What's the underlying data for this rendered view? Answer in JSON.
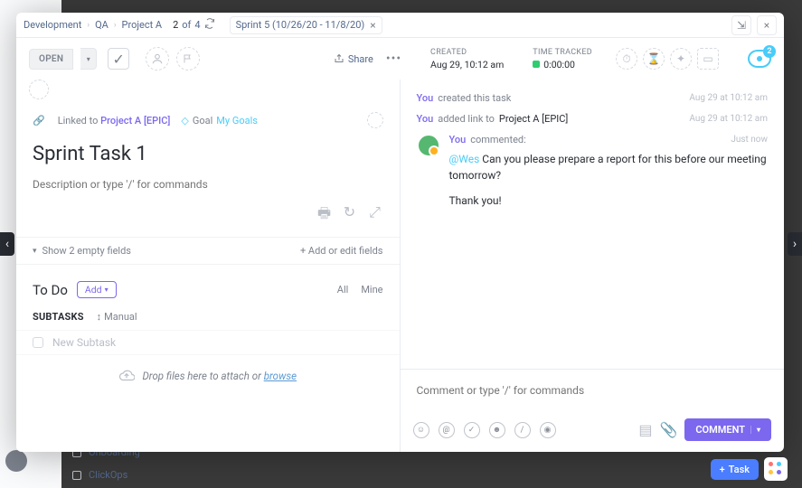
{
  "breadcrumbs": [
    "Development",
    "QA",
    "Project A"
  ],
  "pager": {
    "current": "2",
    "of": "of",
    "total": "4"
  },
  "sprint_chip": "Sprint 5 (10/26/20 - 11/8/20)",
  "status_btn": "OPEN",
  "share_label": "Share",
  "meta": {
    "created_label": "CREATED",
    "created_val": "Aug 29, 10:12 am",
    "tracked_label": "TIME TRACKED",
    "tracked_val": "0:00:00"
  },
  "watchers_count": "2",
  "linked": {
    "prefix": "Linked to ",
    "target": "Project A [EPIC]"
  },
  "goal": {
    "label": "Goal ",
    "target": "My Goals"
  },
  "task_title": "Sprint Task 1",
  "desc_placeholder": "Description or type '/' for commands",
  "fields": {
    "show": "Show 2 empty fields",
    "add": "+ Add or edit fields"
  },
  "todo": {
    "title": "To Do",
    "add": "Add",
    "tab_all": "All",
    "tab_mine": "Mine"
  },
  "subtasks": {
    "label": "SUBTASKS",
    "manual": "Manual",
    "new": "New Subtask"
  },
  "drop": {
    "text": "Drop files here to attach or ",
    "browse": "browse"
  },
  "activity": {
    "l1": {
      "who": "You",
      "text": "created this task",
      "time": "Aug 29 at 10:12 am"
    },
    "l2": {
      "who": "You",
      "text": "added link to ",
      "target": "Project A [EPIC]",
      "time": "Aug 29 at 10:12 am"
    },
    "comment": {
      "who": "You",
      "verb": "commented:",
      "time": "Just now",
      "mention": "@Wes",
      "body": "Can you please prepare a report for this before our meeting tomorrow?",
      "body2": "Thank you!"
    }
  },
  "composer": {
    "placeholder": "Comment or type '/' for commands",
    "btn": "COMMENT"
  },
  "bottom": {
    "task_btn": "Task"
  },
  "bg": {
    "row1": "Onboarding",
    "row2": "ClickOps"
  }
}
